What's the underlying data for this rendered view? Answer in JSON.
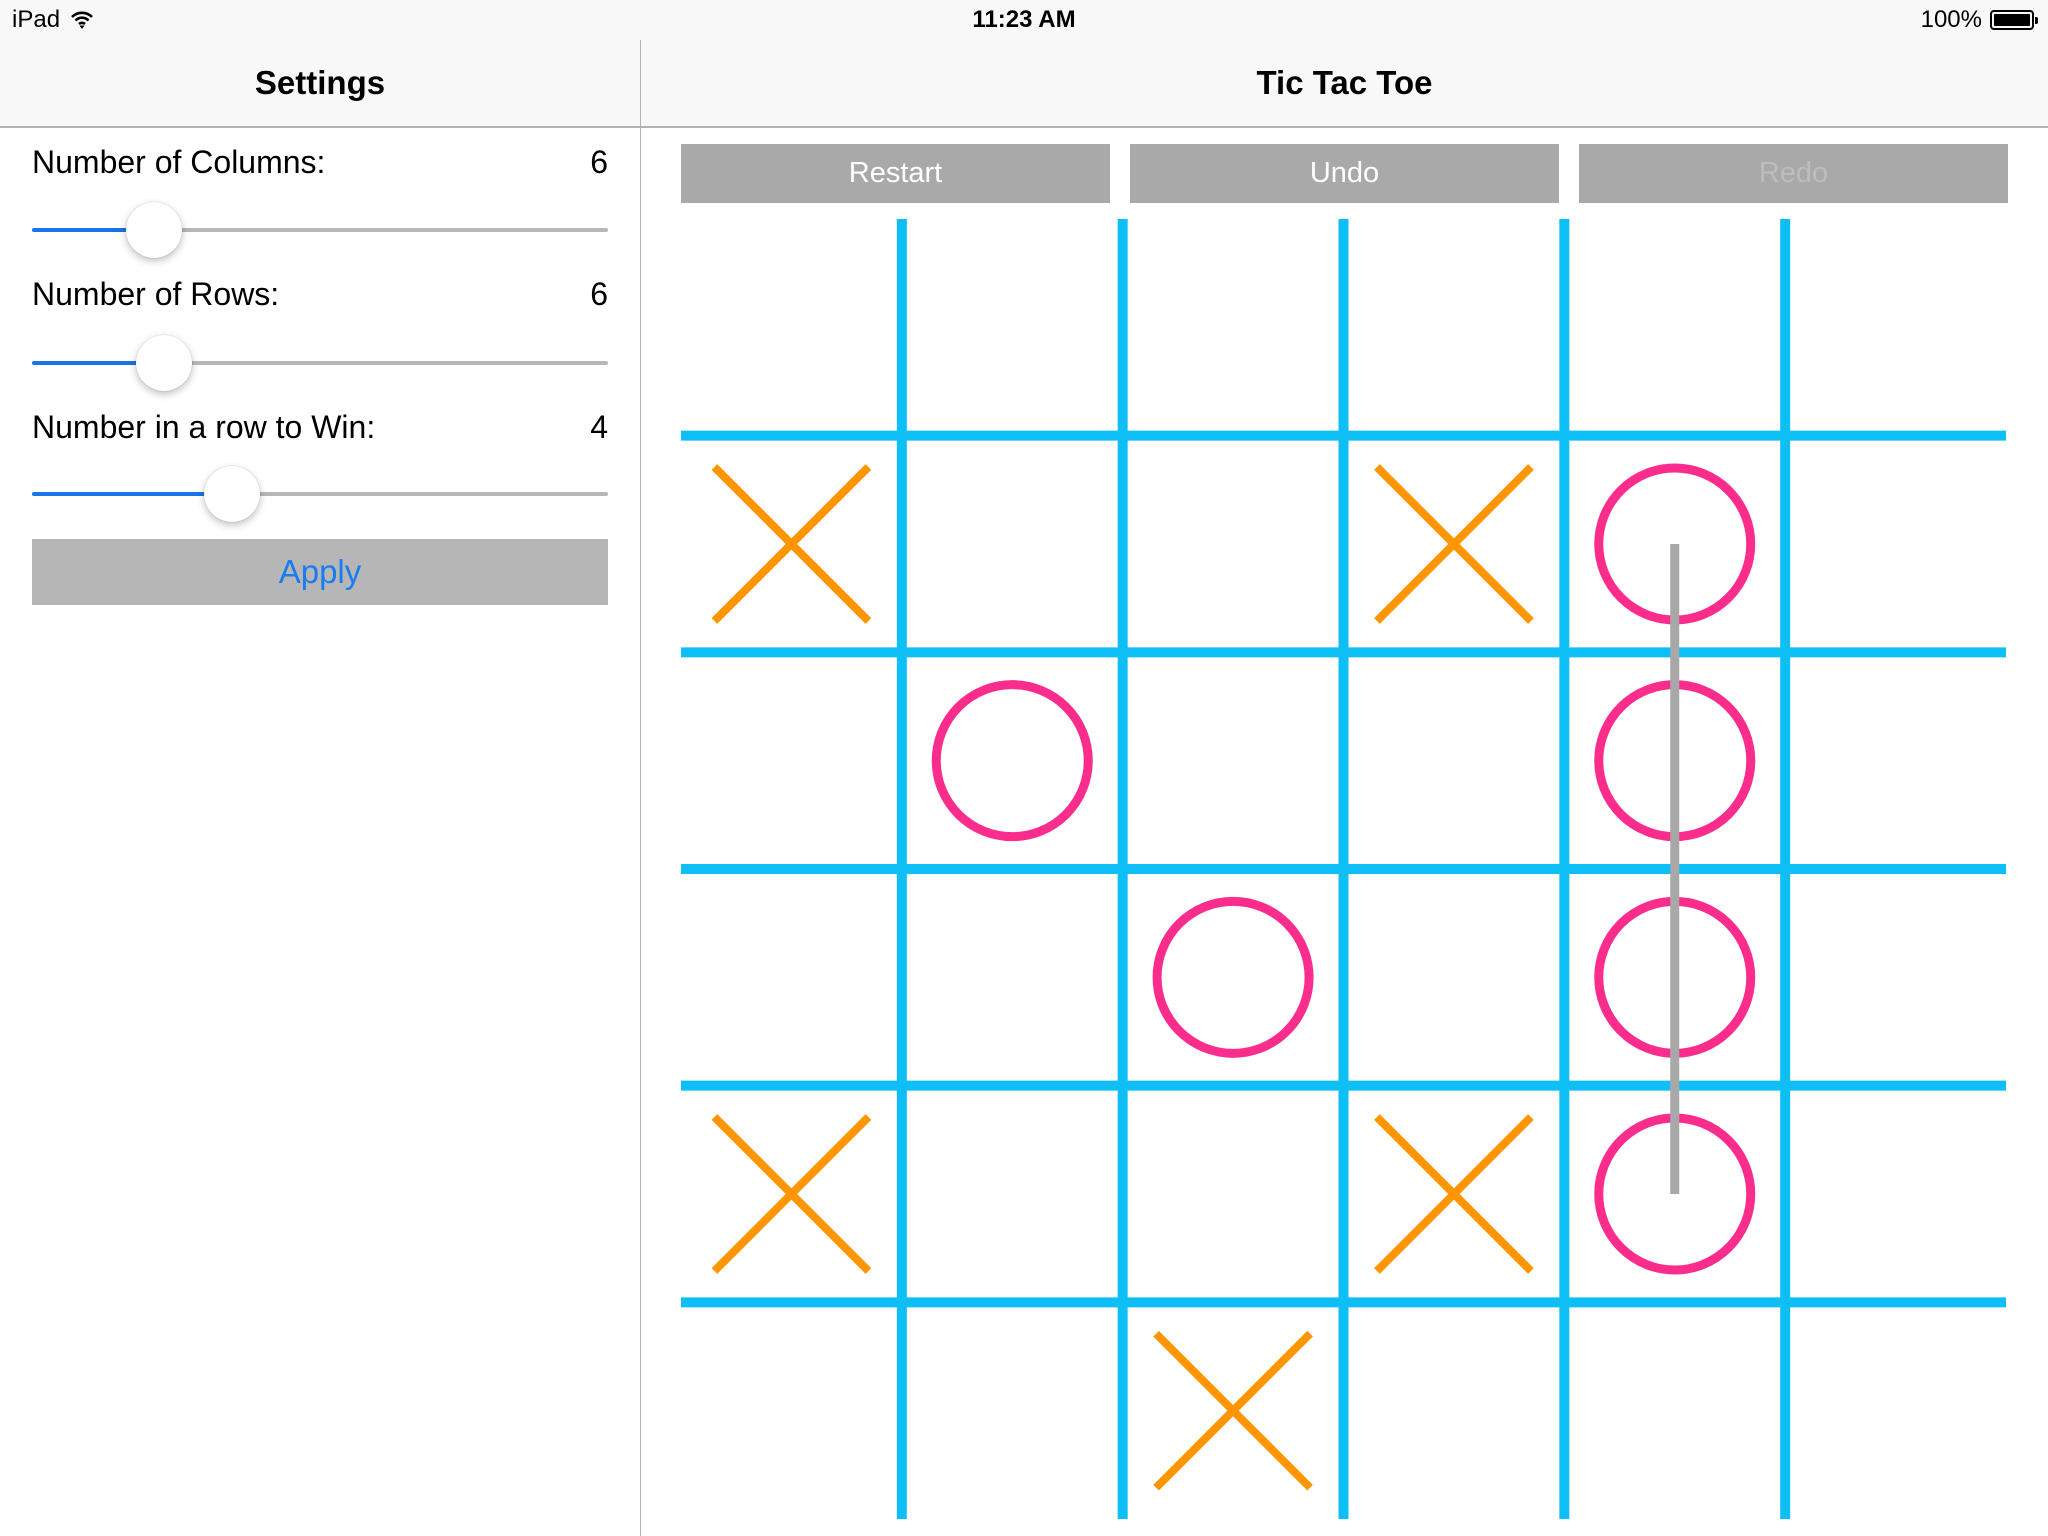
{
  "status_bar": {
    "device": "iPad",
    "wifi_icon": "wifi-icon",
    "time": "11:23 AM",
    "battery_text": "100%",
    "battery_icon": "battery-icon",
    "battery_level": 1.0
  },
  "sidebar": {
    "title": "Settings",
    "settings": [
      {
        "label": "Number of Columns:",
        "value": "6",
        "slider_fraction": 0.18
      },
      {
        "label": "Number of Rows:",
        "value": "6",
        "slider_fraction": 0.2
      },
      {
        "label": "Number in a row to Win:",
        "value": "4",
        "slider_fraction": 0.33
      }
    ],
    "apply_label": "Apply"
  },
  "main": {
    "title": "Tic Tac Toe",
    "buttons": [
      {
        "label": "Restart",
        "enabled": true
      },
      {
        "label": "Undo",
        "enabled": true
      },
      {
        "label": "Redo",
        "enabled": false
      }
    ]
  },
  "game": {
    "columns": 6,
    "rows": 6,
    "win_length": 4,
    "board": [
      [
        "",
        "",
        "",
        "",
        "",
        ""
      ],
      [
        "X",
        "",
        "",
        "X",
        "O",
        ""
      ],
      [
        "",
        "O",
        "",
        "",
        "O",
        ""
      ],
      [
        "",
        "",
        "O",
        "",
        "O",
        ""
      ],
      [
        "X",
        "",
        "",
        "X",
        "O",
        ""
      ],
      [
        "",
        "",
        "X",
        "",
        "",
        ""
      ]
    ],
    "win_line": {
      "from": [
        1,
        4
      ],
      "to": [
        4,
        4
      ],
      "player": "O"
    },
    "colors": {
      "grid": "#0dbff5",
      "x": "#ff9500",
      "o": "#fa2d8c",
      "win_line": "#a8a8a8"
    }
  }
}
